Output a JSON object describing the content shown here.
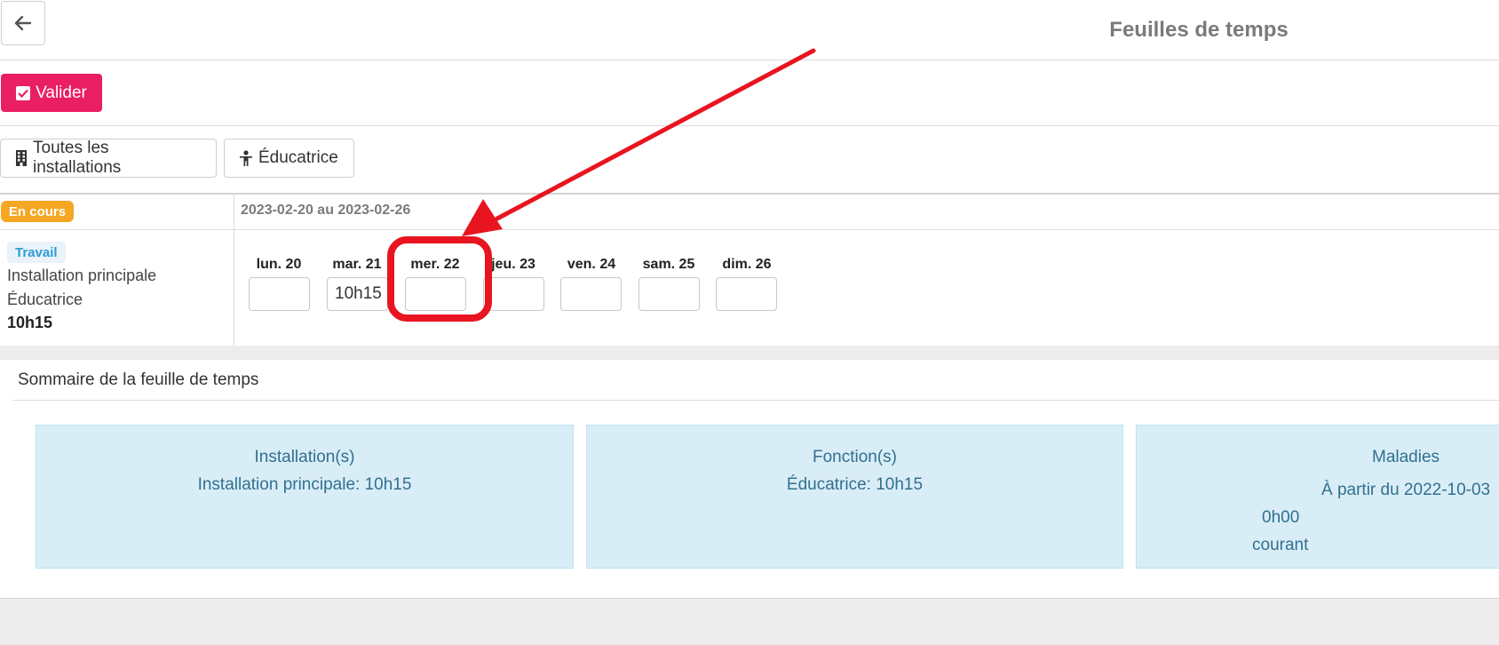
{
  "header": {
    "title": "Feuilles de temps"
  },
  "toolbar": {
    "validate_label": "Valider"
  },
  "filters": {
    "installations_label": "Toutes les installations",
    "role_label": "Éducatrice"
  },
  "period": {
    "status": "En cours",
    "date_range": "2023-02-20 au 2023-02-26"
  },
  "entry": {
    "type": "Travail",
    "installation": "Installation principale",
    "function": "Éducatrice",
    "total": "10h15",
    "days": [
      {
        "label": "lun. 20",
        "value": ""
      },
      {
        "label": "mar. 21",
        "value": "10h15"
      },
      {
        "label": "mer. 22",
        "value": ""
      },
      {
        "label": "jeu. 23",
        "value": ""
      },
      {
        "label": "ven. 24",
        "value": ""
      },
      {
        "label": "sam. 25",
        "value": ""
      },
      {
        "label": "dim. 26",
        "value": ""
      }
    ]
  },
  "summary": {
    "title": "Sommaire de la feuille de temps",
    "installations": {
      "title": "Installation(s)",
      "line": "Installation principale: 10h15"
    },
    "functions": {
      "title": "Fonction(s)",
      "line": "Éducatrice: 10h15"
    },
    "sick": {
      "title": "Maladies",
      "since": "À partir du 2022-10-03",
      "balance": "0h00",
      "period": "courant"
    }
  },
  "colors": {
    "accent": "#e91e63",
    "status_badge": "#f5a623",
    "type_badge_text": "#2e9ad6",
    "annotation": "#e8141f",
    "card_bg": "#d9edf7"
  }
}
